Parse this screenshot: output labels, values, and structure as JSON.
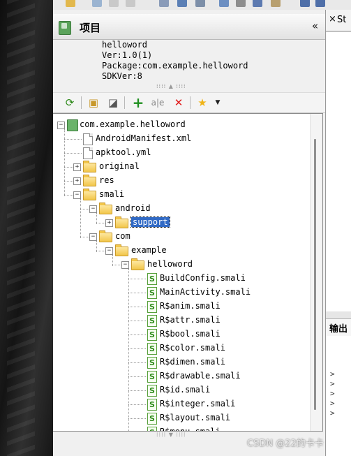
{
  "panel": {
    "title": "项目",
    "collapse": "«"
  },
  "project_info": [
    "helloword",
    "Ver:1.0(1)",
    "Package:com.example.helloword",
    "SDKVer:8"
  ],
  "toolbar_icons": [
    "refresh-icon",
    "open-folder-icon",
    "box-icon",
    "add-icon",
    "rename-icon",
    "delete-icon",
    "star-icon",
    "dropdown-arrow-icon"
  ],
  "tree": [
    {
      "label": "com.example.helloword",
      "icon": "project-icon",
      "expander": "minus",
      "level": 0
    },
    {
      "label": "AndroidManifest.xml",
      "icon": "file-icon",
      "expander": "none",
      "level": 1
    },
    {
      "label": "apktool.yml",
      "icon": "file-icon",
      "expander": "none",
      "level": 1
    },
    {
      "label": "original",
      "icon": "folder-icon",
      "expander": "plus",
      "level": 1
    },
    {
      "label": "res",
      "icon": "folder-icon",
      "expander": "plus",
      "level": 1
    },
    {
      "label": "smali",
      "icon": "folder-icon",
      "expander": "minus",
      "level": 1
    },
    {
      "label": "android",
      "icon": "folder-icon",
      "expander": "minus",
      "level": 2
    },
    {
      "label": "support",
      "icon": "folder-icon",
      "expander": "plus",
      "level": 3,
      "selected": true
    },
    {
      "label": "com",
      "icon": "folder-icon",
      "expander": "minus",
      "level": 2
    },
    {
      "label": "example",
      "icon": "folder-icon",
      "expander": "minus",
      "level": 3
    },
    {
      "label": "helloword",
      "icon": "folder-icon",
      "expander": "minus",
      "level": 4
    },
    {
      "label": "BuildConfig.smali",
      "icon": "smali-icon",
      "expander": "none",
      "level": 5
    },
    {
      "label": "MainActivity.smali",
      "icon": "smali-icon",
      "expander": "none",
      "level": 5
    },
    {
      "label": "R$anim.smali",
      "icon": "smali-icon",
      "expander": "none",
      "level": 5
    },
    {
      "label": "R$attr.smali",
      "icon": "smali-icon",
      "expander": "none",
      "level": 5
    },
    {
      "label": "R$bool.smali",
      "icon": "smali-icon",
      "expander": "none",
      "level": 5
    },
    {
      "label": "R$color.smali",
      "icon": "smali-icon",
      "expander": "none",
      "level": 5
    },
    {
      "label": "R$dimen.smali",
      "icon": "smali-icon",
      "expander": "none",
      "level": 5
    },
    {
      "label": "R$drawable.smali",
      "icon": "smali-icon",
      "expander": "none",
      "level": 5
    },
    {
      "label": "R$id.smali",
      "icon": "smali-icon",
      "expander": "none",
      "level": 5
    },
    {
      "label": "R$integer.smali",
      "icon": "smali-icon",
      "expander": "none",
      "level": 5
    },
    {
      "label": "R$layout.smali",
      "icon": "smali-icon",
      "expander": "none",
      "level": 5
    },
    {
      "label": "R$menu.smali",
      "icon": "smali-icon",
      "expander": "none",
      "level": 5
    }
  ],
  "right_panel": {
    "tab_close": "×",
    "tab_label": "St",
    "output_title": "输出"
  },
  "watermark": "CSDN @22的卡卡",
  "colors": {
    "selection": "#316ac5",
    "smali_green": "#2f8a1b",
    "folder": "#f2c64a"
  }
}
